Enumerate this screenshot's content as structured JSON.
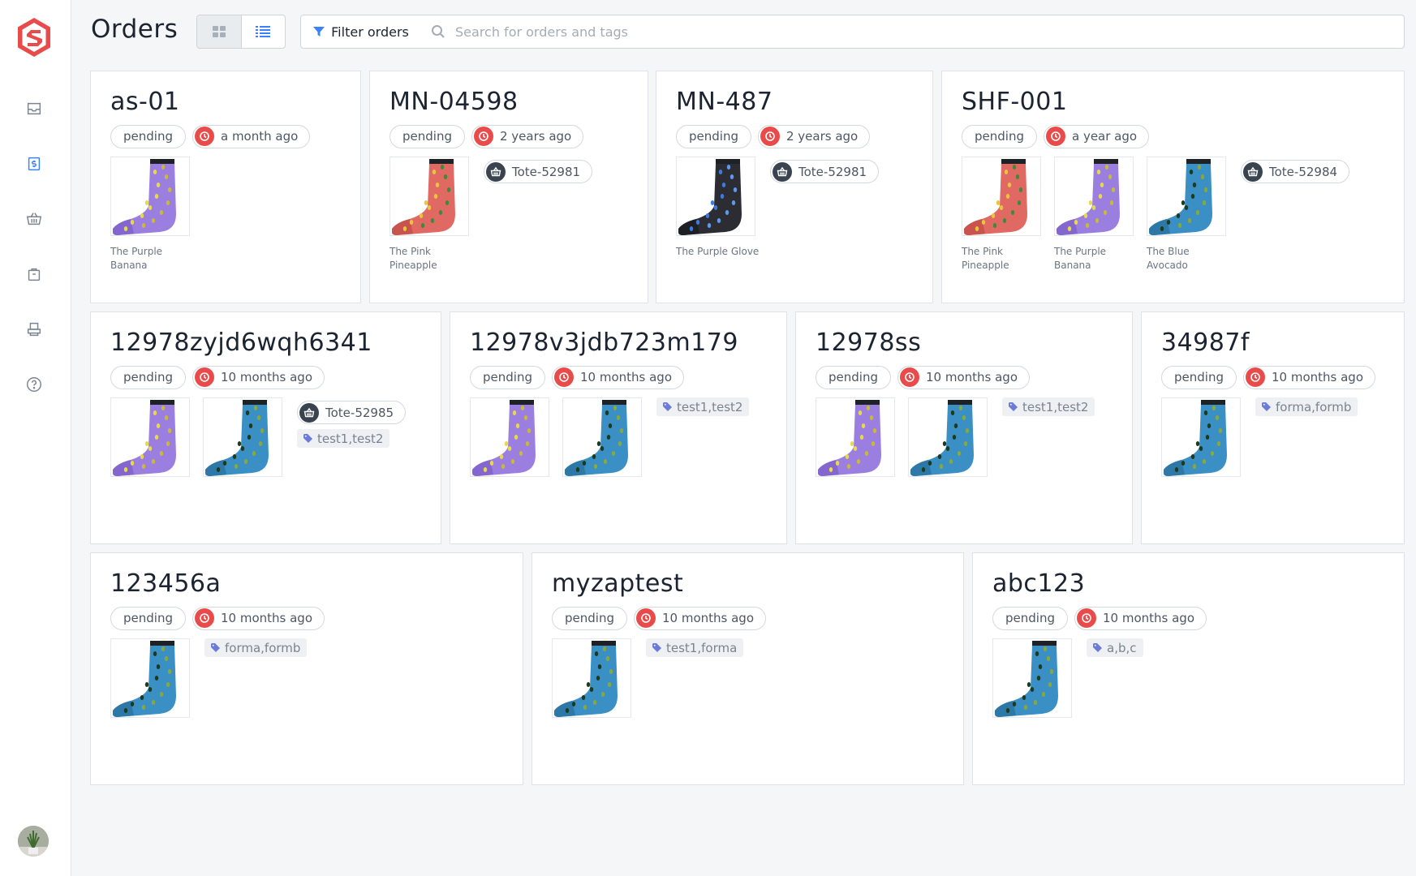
{
  "header": {
    "title": "Orders",
    "filter_label": "Filter orders",
    "search_placeholder": "Search for orders and tags"
  },
  "colors": {
    "accent": "#e94b4b",
    "nav_active": "#3b82f6",
    "tote": "#3a4350"
  },
  "sidebar": {
    "items": [
      {
        "icon": "inbox-icon"
      },
      {
        "icon": "dollar-invoice-icon",
        "active": true
      },
      {
        "icon": "basket-icon"
      },
      {
        "icon": "package-icon"
      },
      {
        "icon": "printer-icon"
      },
      {
        "icon": "help-icon"
      }
    ]
  },
  "orders": [
    {
      "id": "as-01",
      "status": "pending",
      "time": "a month ago",
      "products": [
        {
          "name": "The Purple Banana",
          "variant": "purple"
        }
      ],
      "tote": "",
      "tags": ""
    },
    {
      "id": "MN-04598",
      "status": "pending",
      "time": "2 years ago",
      "products": [
        {
          "name": "The Pink Pineapple",
          "variant": "pink"
        }
      ],
      "tote": "Tote-52981",
      "tags": ""
    },
    {
      "id": "MN-487",
      "status": "pending",
      "time": "2 years ago",
      "products": [
        {
          "name": "The Purple Glove",
          "variant": "black"
        }
      ],
      "tote": "Tote-52981",
      "tags": ""
    },
    {
      "id": "SHF-001",
      "status": "pending",
      "time": "a year ago",
      "products": [
        {
          "name": "The Pink Pineapple",
          "variant": "pink"
        },
        {
          "name": "The Purple Banana",
          "variant": "purple"
        },
        {
          "name": "The Blue Avocado",
          "variant": "blue"
        }
      ],
      "tote": "Tote-52984",
      "tags": ""
    },
    {
      "id": "12978zyjd6wqh6341",
      "status": "pending",
      "time": "10 months ago",
      "products": [
        {
          "name": "",
          "variant": "purple"
        },
        {
          "name": "",
          "variant": "blue"
        }
      ],
      "tote": "Tote-52985",
      "tags": "test1,test2"
    },
    {
      "id": "12978v3jdb723m179",
      "status": "pending",
      "time": "10 months ago",
      "products": [
        {
          "name": "",
          "variant": "purple"
        },
        {
          "name": "",
          "variant": "blue"
        }
      ],
      "tote": "",
      "tags": "test1,test2"
    },
    {
      "id": "12978ss",
      "status": "pending",
      "time": "10 months ago",
      "products": [
        {
          "name": "",
          "variant": "purple"
        },
        {
          "name": "",
          "variant": "blue"
        }
      ],
      "tote": "",
      "tags": "test1,test2"
    },
    {
      "id": "34987f",
      "status": "pending",
      "time": "10 months ago",
      "products": [
        {
          "name": "",
          "variant": "blue"
        }
      ],
      "tote": "",
      "tags": "forma,formb"
    },
    {
      "id": "123456a",
      "status": "pending",
      "time": "10 months ago",
      "products": [
        {
          "name": "",
          "variant": "blue"
        }
      ],
      "tote": "",
      "tags": "forma,formb"
    },
    {
      "id": "myzaptest",
      "status": "pending",
      "time": "10 months ago",
      "products": [
        {
          "name": "",
          "variant": "blue"
        }
      ],
      "tote": "",
      "tags": "test1,forma"
    },
    {
      "id": "abc123",
      "status": "pending",
      "time": "10 months ago",
      "products": [
        {
          "name": "",
          "variant": "blue"
        }
      ],
      "tote": "",
      "tags": "a,b,c"
    }
  ]
}
